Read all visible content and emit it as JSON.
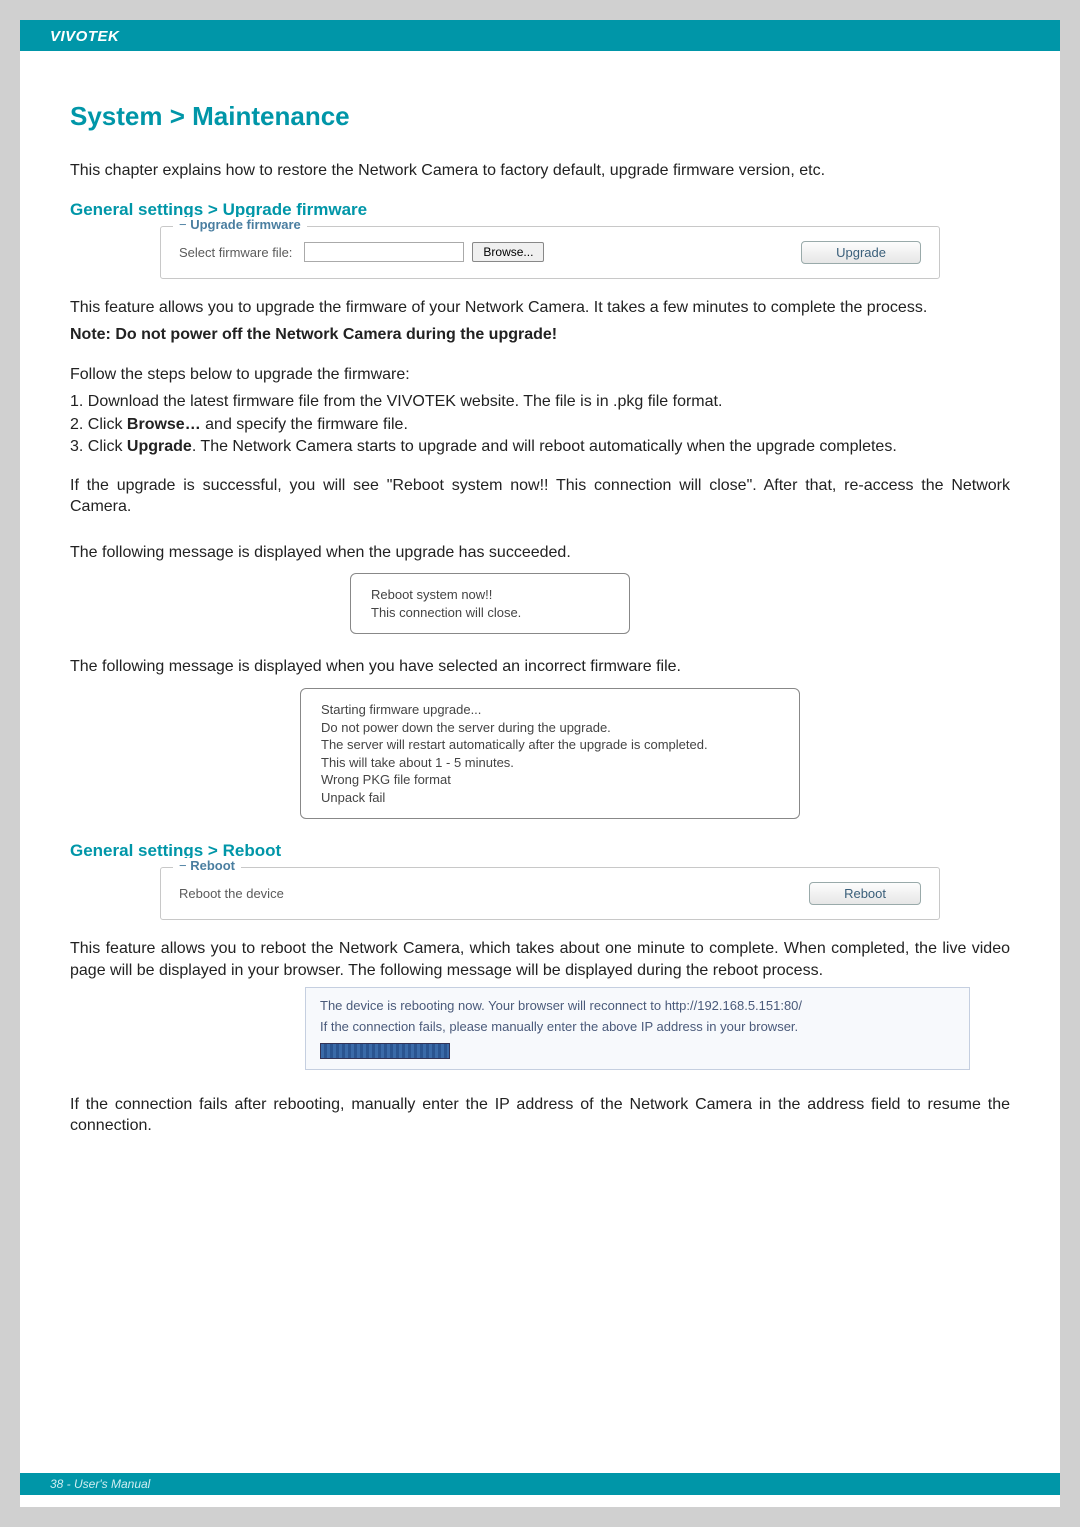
{
  "header": {
    "brand": "VIVOTEK"
  },
  "title": "System > Maintenance",
  "intro": "This chapter explains how to restore the Network Camera to factory default, upgrade firmware version, etc.",
  "upgrade": {
    "heading": "General settings > Upgrade firmware",
    "legend": "Upgrade firmware",
    "select_label": "Select firmware file:",
    "browse_label": "Browse...",
    "upgrade_label": "Upgrade",
    "feature_text": "This feature allows you to upgrade the firmware of your Network Camera. It takes a few minutes to complete the process.",
    "note_text": "Note: Do not power off the Network Camera during the upgrade!",
    "follow_text": "Follow the steps below to upgrade the firmware:",
    "steps": {
      "s1": "1. Download the latest firmware file from the VIVOTEK website. The file is in .pkg file format.",
      "s2_a": "2. Click ",
      "s2_b": "Browse…",
      "s2_c": " and specify the firmware file.",
      "s3_a": "3. Click ",
      "s3_b": "Upgrade",
      "s3_c": ". The Network Camera starts to upgrade and will reboot automatically when the upgrade completes."
    },
    "success_text": "If the upgrade is successful, you will see \"Reboot system now!! This connection will close\". After that, re-access the Network Camera.",
    "success_msg_label": "The following message is displayed when the upgrade has succeeded.",
    "success_box": "Reboot system now!!\nThis connection will close.",
    "fail_msg_label": "The following message is displayed when you have selected an incorrect firmware file.",
    "fail_box": "Starting firmware upgrade...\nDo not power down the server during the upgrade.\nThe server will restart automatically after the upgrade is completed.\nThis will take about 1 - 5 minutes.\nWrong PKG file format\nUnpack fail"
  },
  "reboot": {
    "heading": "General settings > Reboot",
    "legend": "Reboot",
    "row_label": "Reboot the device",
    "button_label": "Reboot",
    "feature_text": "This feature allows you to reboot the Network Camera, which takes about one minute to complete. When completed, the live video page will be displayed in your browser. The following message will be displayed during the reboot process.",
    "panel_line1": "The device is rebooting now. Your browser will reconnect to http://192.168.5.151:80/",
    "panel_line2": "If the connection fails, please manually enter the above IP address in your browser.",
    "post_text": "If the connection fails after rebooting, manually enter the IP address of the Network Camera in the address field to resume the connection."
  },
  "footer": {
    "text": "38 - User's Manual"
  }
}
